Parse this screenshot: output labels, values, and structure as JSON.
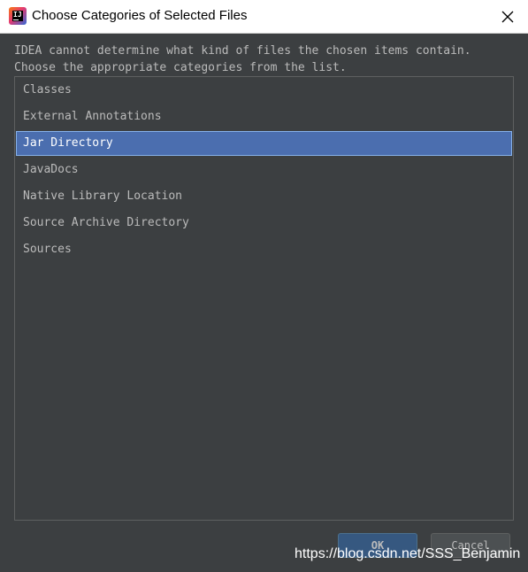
{
  "window": {
    "title": "Choose Categories of Selected Files",
    "app_icon": "intellij-idea-icon",
    "close_icon": "close-icon"
  },
  "message": {
    "line1": "IDEA cannot determine what kind of files the chosen items contain.",
    "line2": "Choose the appropriate categories from the list."
  },
  "categories": {
    "items": [
      {
        "label": "Classes"
      },
      {
        "label": "External Annotations"
      },
      {
        "label": "Jar Directory"
      },
      {
        "label": "JavaDocs"
      },
      {
        "label": "Native Library Location"
      },
      {
        "label": "Source Archive Directory"
      },
      {
        "label": "Sources"
      }
    ],
    "selected": "Jar Directory"
  },
  "buttons": {
    "ok_label": "OK",
    "cancel_label": "Cancel"
  },
  "watermark": "https://blog.csdn.net/SSS_Benjamin",
  "colors": {
    "background": "#3c3f41",
    "selection": "#4b6eaf",
    "text": "#bbbbbb",
    "default_button": "#365880"
  }
}
